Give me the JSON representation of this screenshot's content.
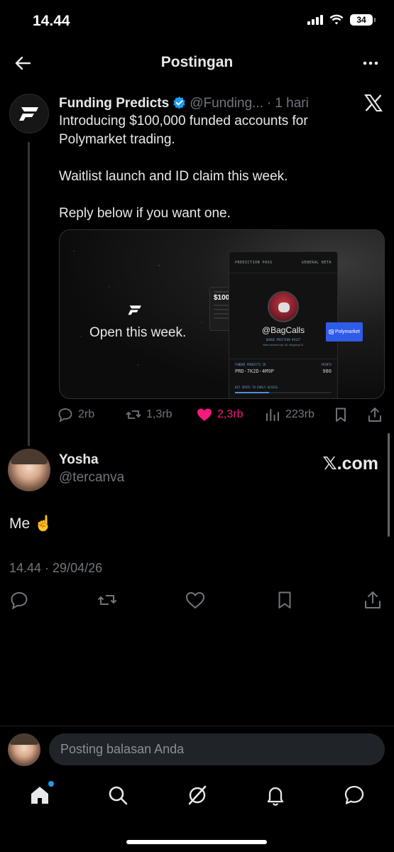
{
  "status_bar": {
    "time": "14.44",
    "battery": "34"
  },
  "header": {
    "title": "Postingan"
  },
  "quoted_post": {
    "author": "Funding Predicts",
    "handle": "@Funding...",
    "separator": "·",
    "time": "1 hari",
    "lines": [
      "Introducing $100,000 funded accounts for Polymarket trading.",
      "Waitlist launch and ID claim this week.",
      "Reply below if you want one."
    ],
    "media": {
      "caption": "Open this week.",
      "pass_title": "PREDICTION PASS",
      "pass_badge": "GENERAL BETA",
      "amount_label": "FUNDED AMOUNT",
      "amount": "$100K",
      "handle": "@BagCalls",
      "queue_label": "QUEUE POSITION #4127",
      "queue_sub": "Beta access Apr 28, shipping 01",
      "id_label": "FUNDED PREDICTS ID",
      "points_label": "POINTS",
      "id": "PRD-7K2D-4M9P",
      "points": "980",
      "progress_label": "647 SPOTS TO EARLY ACCESS",
      "progress": 0.35,
      "platform": "Polymarket"
    },
    "stats": {
      "replies": "2rb",
      "reposts": "1,3rb",
      "likes": "2,3rb",
      "views": "223rb"
    }
  },
  "reply_post": {
    "author": "Yosha",
    "handle": "@tercanva",
    "watermark": "𝕏.com",
    "text": "Me ☝️",
    "timestamp": "14.44 · 29/04/26"
  },
  "composer": {
    "placeholder": "Posting balasan Anda"
  },
  "colors": {
    "accent": "#1d9bf0",
    "like": "#f91880",
    "muted": "#71767b"
  }
}
